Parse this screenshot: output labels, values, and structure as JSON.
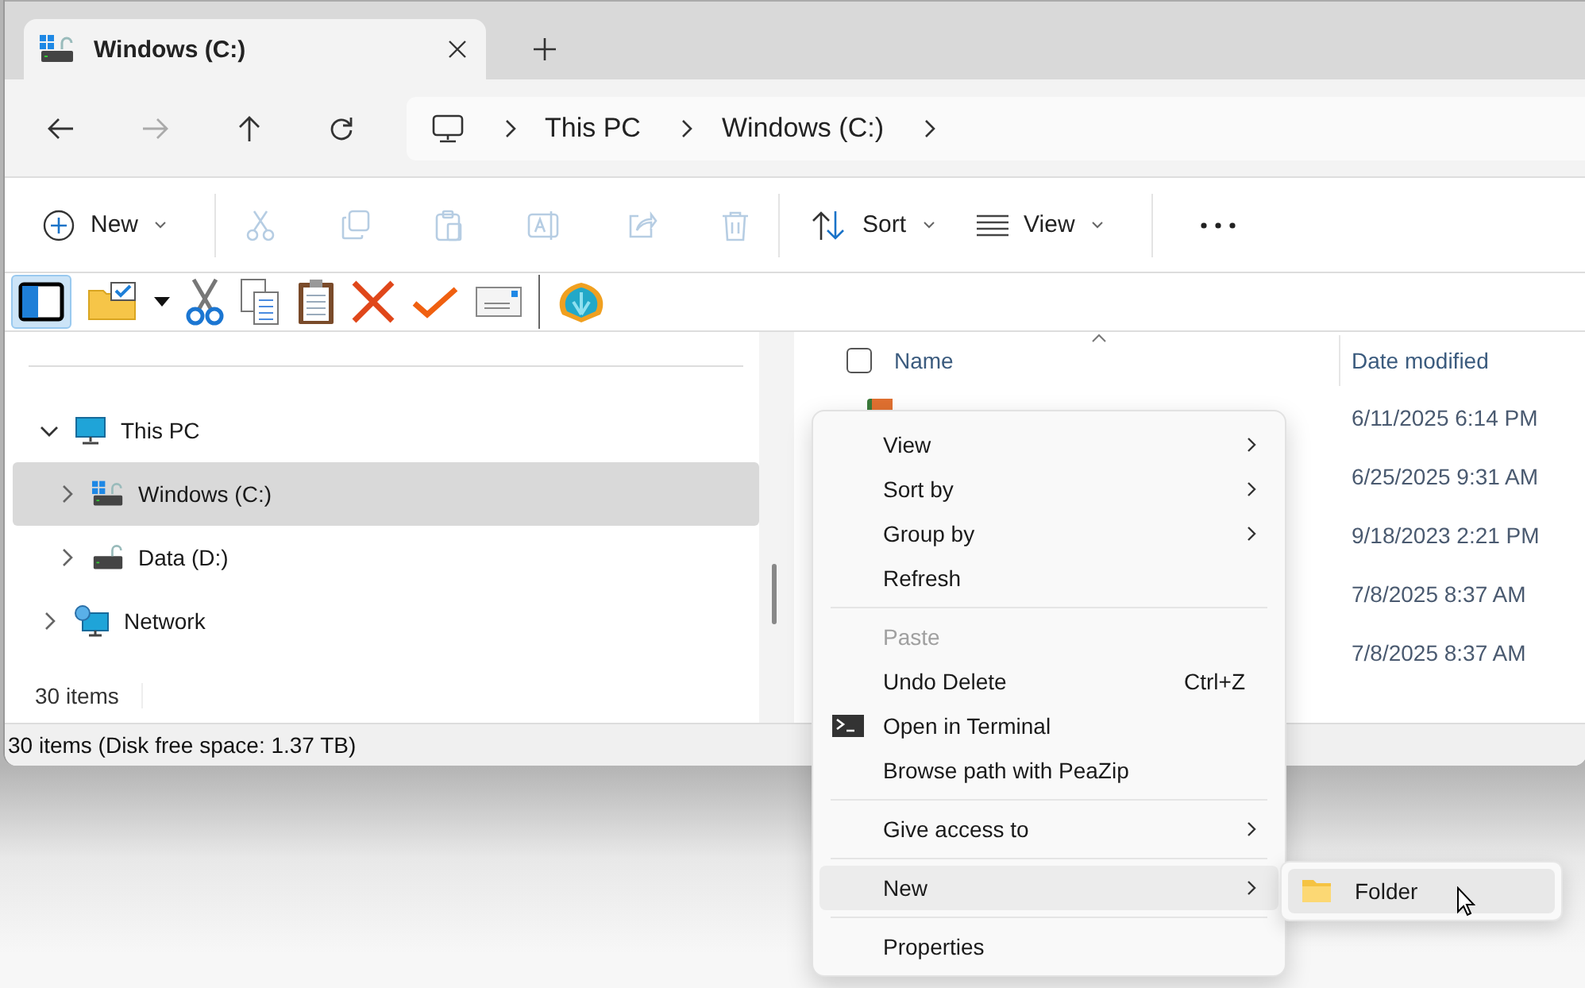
{
  "tab": {
    "title": "Windows (C:)",
    "selected": true
  },
  "address": {
    "crumbs": [
      "This PC",
      "Windows (C:)"
    ]
  },
  "command_bar": {
    "new_label": "New",
    "clipboard_actions_disabled": true,
    "sort_label": "Sort",
    "view_label": "View"
  },
  "nav_tree": [
    {
      "label": "This PC",
      "kind": "pc",
      "expanded": true,
      "selected": false,
      "children": [
        {
          "label": "Windows (C:)",
          "kind": "drive-system",
          "expanded": false,
          "selected": true
        },
        {
          "label": "Data (D:)",
          "kind": "drive",
          "expanded": false,
          "selected": false
        }
      ]
    },
    {
      "label": "Network",
      "kind": "network",
      "expanded": false,
      "selected": false
    }
  ],
  "pane_status": "30 items",
  "file_list": {
    "select_all_checked": false,
    "columns": [
      "Name",
      "Date modified"
    ],
    "rows": [
      {
        "date": "6/11/2025 6:14 PM"
      },
      {
        "date": "6/25/2025 9:31 AM"
      },
      {
        "date": "9/18/2023 2:21 PM"
      },
      {
        "date": "7/8/2025 8:37 AM"
      },
      {
        "date": "7/8/2025 8:37 AM"
      }
    ]
  },
  "status_bar": "30 items (Disk free space: 1.37 TB)",
  "context_menu": [
    {
      "kind": "item",
      "label": "View",
      "submenu": true,
      "disabled": false,
      "selected": false
    },
    {
      "kind": "item",
      "label": "Sort by",
      "submenu": true,
      "disabled": false,
      "selected": false
    },
    {
      "kind": "item",
      "label": "Group by",
      "submenu": true,
      "disabled": false,
      "selected": false
    },
    {
      "kind": "item",
      "label": "Refresh",
      "submenu": false,
      "disabled": false,
      "selected": false
    },
    {
      "kind": "separator"
    },
    {
      "kind": "item",
      "label": "Paste",
      "submenu": false,
      "disabled": true,
      "selected": false
    },
    {
      "kind": "item",
      "label": "Undo Delete",
      "shortcut": "Ctrl+Z",
      "submenu": false,
      "disabled": false,
      "selected": false
    },
    {
      "kind": "terminal",
      "label": "Open in Terminal",
      "submenu": false,
      "disabled": false,
      "selected": false
    },
    {
      "kind": "item",
      "label": "Browse path with PeaZip",
      "submenu": false,
      "disabled": false,
      "selected": false
    },
    {
      "kind": "separator"
    },
    {
      "kind": "item",
      "label": "Give access to",
      "submenu": true,
      "disabled": false,
      "selected": false
    },
    {
      "kind": "separator"
    },
    {
      "kind": "item",
      "label": "New",
      "submenu": true,
      "disabled": false,
      "selected": true
    },
    {
      "kind": "separator"
    },
    {
      "kind": "item",
      "label": "Properties",
      "submenu": false,
      "disabled": false,
      "selected": false
    }
  ],
  "submenu": [
    {
      "label": "Folder",
      "selected": true
    }
  ]
}
